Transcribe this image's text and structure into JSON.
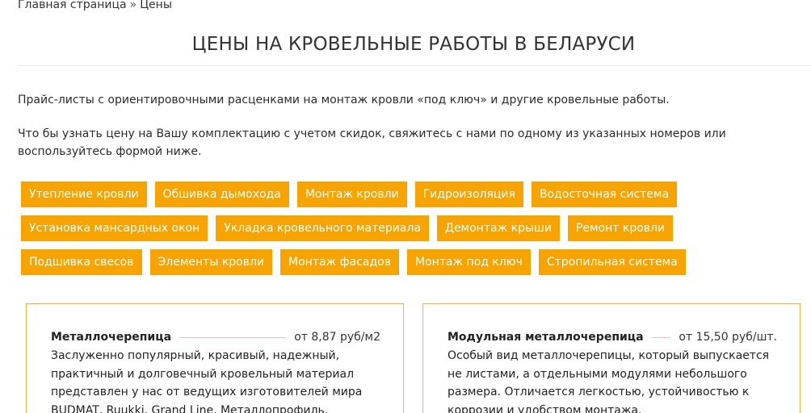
{
  "breadcrumb": {
    "home": "Главная страница",
    "separator": "»",
    "current": "Цены"
  },
  "page": {
    "title": "ЦЕНЫ НА КРОВЕЛЬНЫЕ РАБОТЫ В БЕЛАРУСИ",
    "intro_1": "Прайс-листы с ориентировочными расценками на монтаж кровли «под ключ» и другие кровельные работы.",
    "intro_2": "Что бы узнать цену на Вашу комплектацию с учетом скидок, свяжитесь с нами по одному из указанных номеров или воспользуйтесь формой ниже."
  },
  "tags": {
    "row1": [
      "Утепление кровли",
      "Обшивка дымохода",
      "Монтаж кровли",
      "Гидроизоляция",
      "Водосточная система"
    ],
    "row2": [
      "Установка мансардных окон",
      "Укладка кровельного материала",
      "Демонтаж крыши",
      "Ремонт кровли"
    ],
    "row3": [
      "Подшивка свесов",
      "Элементы кровли",
      "Монтаж фасадов",
      "Монтаж под ключ",
      "Стропильная система"
    ]
  },
  "cards": [
    {
      "name": "Металлочерепица",
      "price": "от 8,87 руб/м2",
      "description": "Заслуженно популярный, красивый, надежный, практичный и долговечный кровельный материал представлен у нас от ведущих изготовителей мира BUDMAT, Ruukki, Grand Line, Металлопрофиль."
    },
    {
      "name": "Модульная металлочерепица",
      "price": "от 15,50 руб/шт.",
      "description": "Особый вид металлочерепицы, который выпускается не листами, а отдельными модулями небольшого размера. Отличается легкостью, устойчивостью к коррозии и удобством монтажа."
    }
  ],
  "colors": {
    "tag_background": "#f8a400",
    "tag_text": "#ffffff",
    "card_border": "#f3b23b"
  }
}
